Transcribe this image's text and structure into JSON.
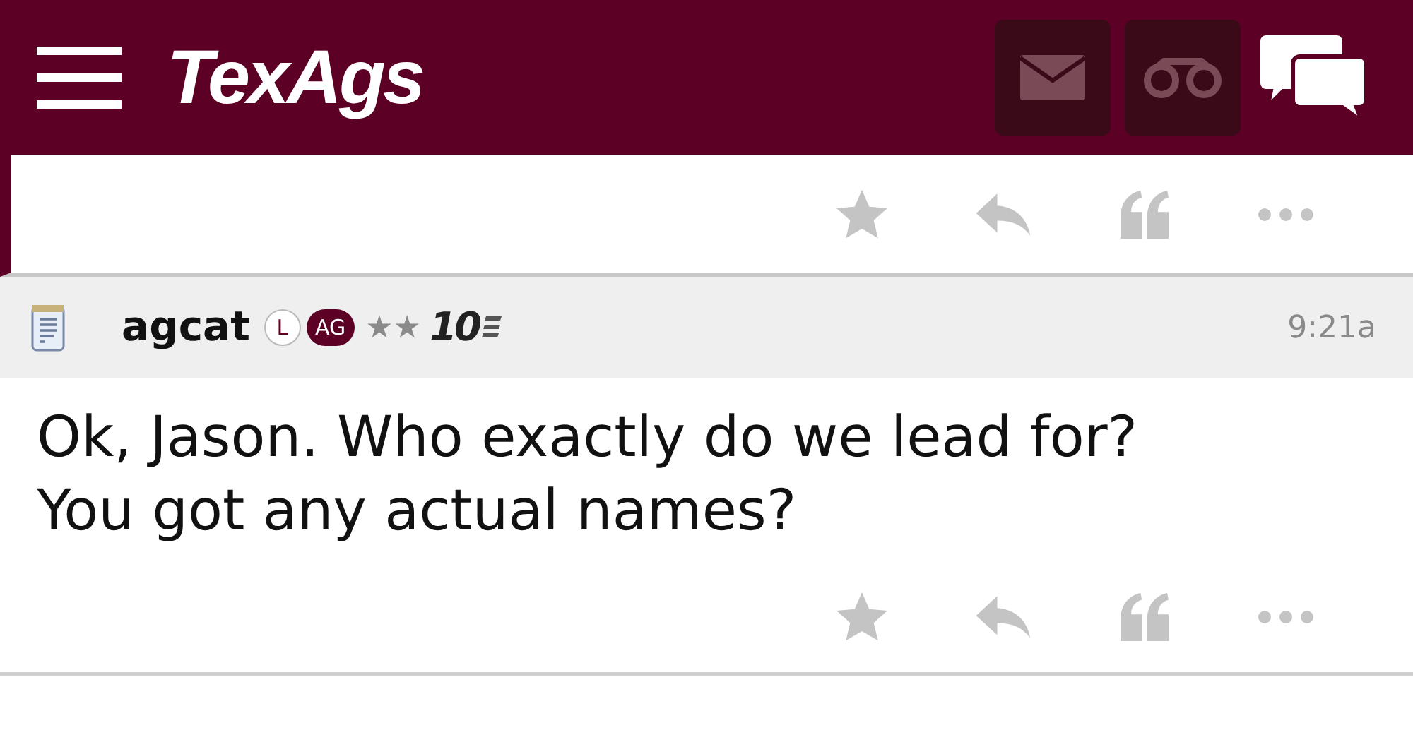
{
  "header": {
    "logo": "TexAgs"
  },
  "posts": [
    {
      "kind": "tail"
    },
    {
      "kind": "full",
      "author": "agcat",
      "badges": [
        "L",
        "AG"
      ],
      "user_stars": "★★",
      "rank": "10",
      "time": "9:21a",
      "body": "Ok, Jason. Who exactly do we lead for? You got any actual names?"
    }
  ]
}
